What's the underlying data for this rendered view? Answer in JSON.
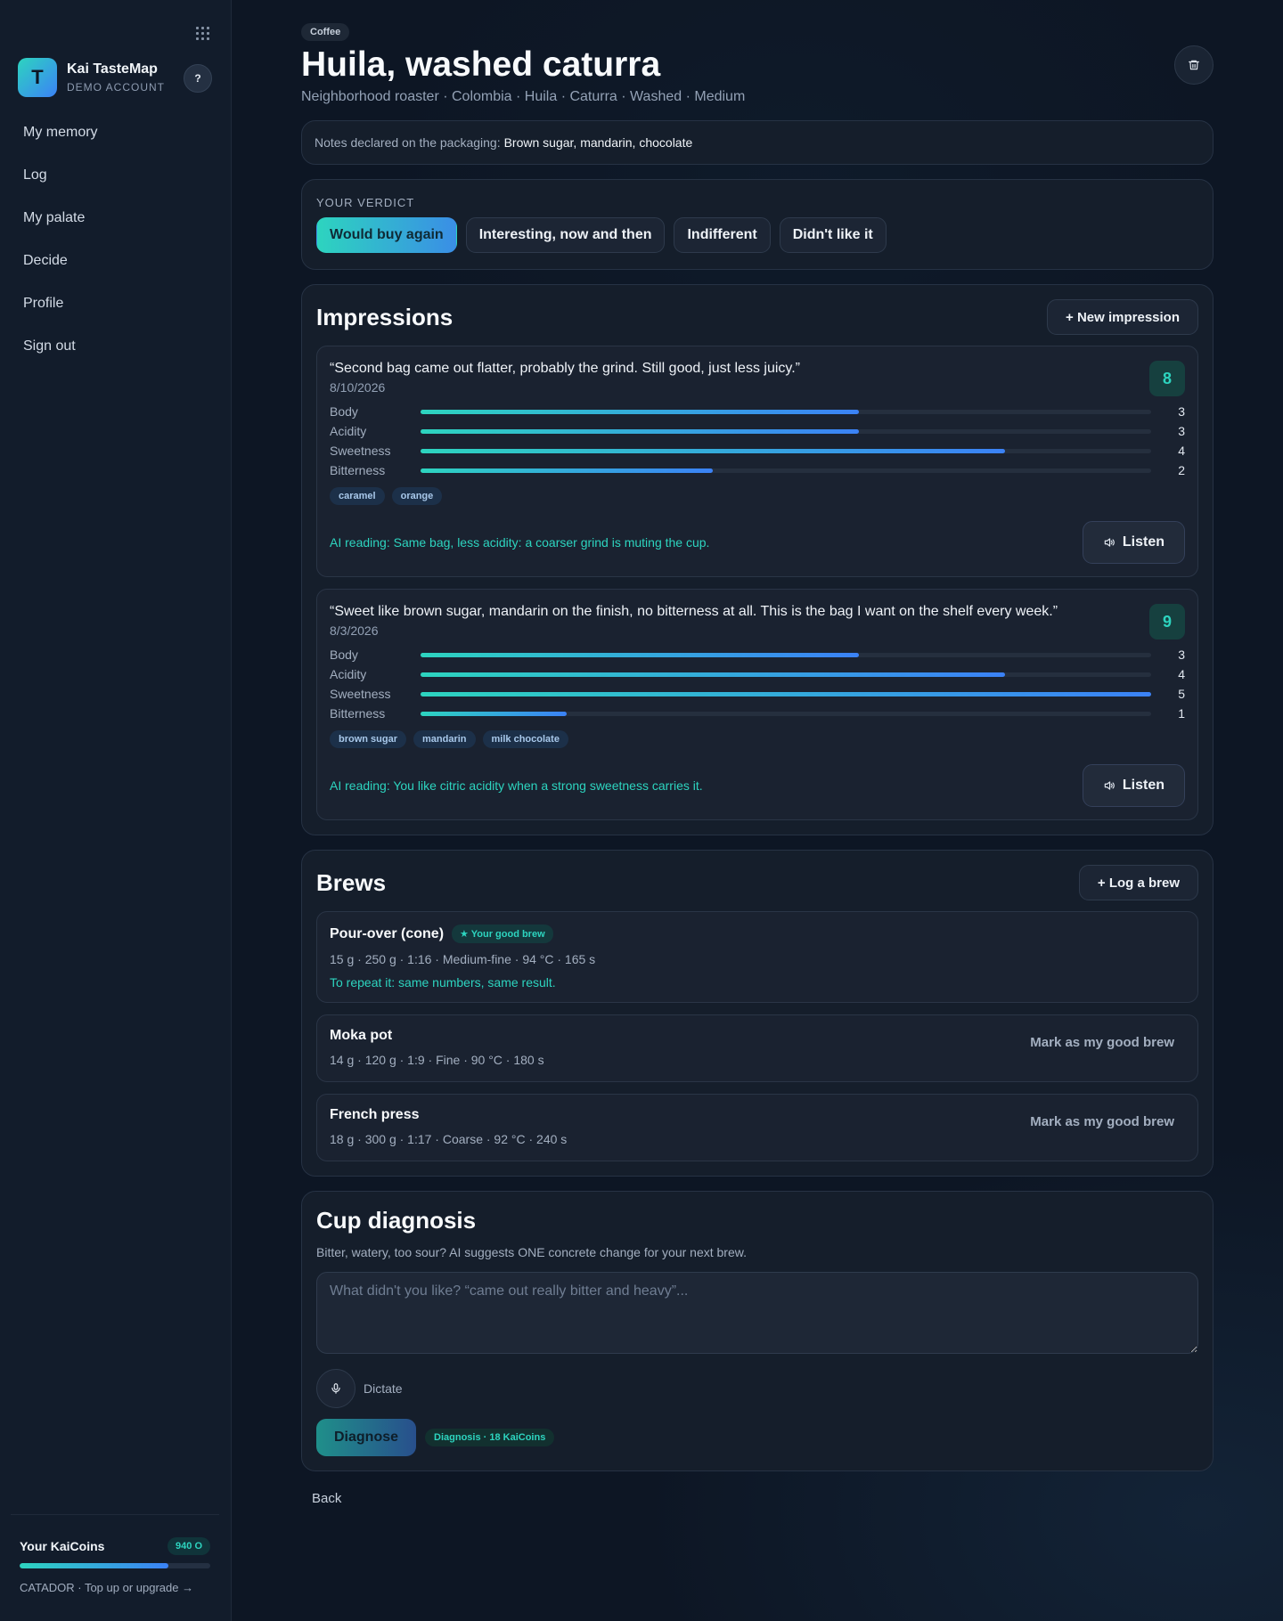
{
  "sidebar": {
    "brand_initial": "T",
    "brand_name": "Kai TasteMap",
    "brand_sub": "DEMO ACCOUNT",
    "help_label": "?",
    "nav": [
      {
        "label": "My memory"
      },
      {
        "label": "Log"
      },
      {
        "label": "My palate"
      },
      {
        "label": "Decide"
      },
      {
        "label": "Profile"
      },
      {
        "label": "Sign out"
      }
    ],
    "coins": {
      "title": "Your KaiCoins",
      "balance": "940 O",
      "progress": 0.78,
      "link": "CATADOR · Top up or upgrade →"
    }
  },
  "header": {
    "category": "Coffee",
    "title": "Huila, washed caturra",
    "subtitle": "Neighborhood roaster · Colombia · Huila · Caturra · Washed · Medium"
  },
  "notes": {
    "label": "Notes declared on the packaging:",
    "value": "Brown sugar, mandarin, chocolate"
  },
  "verdict": {
    "label": "YOUR VERDICT",
    "options": [
      {
        "label": "Would buy again",
        "active": true
      },
      {
        "label": "Interesting, now and then",
        "active": false
      },
      {
        "label": "Indifferent",
        "active": false
      },
      {
        "label": "Didn't like it",
        "active": false
      }
    ]
  },
  "impressions": {
    "title": "Impressions",
    "new_label": "+ New impression",
    "listen_label": "Listen",
    "max_value": 5,
    "items": [
      {
        "quote": "“Second bag came out flatter, probably the grind. Still good, just less juicy.”",
        "date": "8/10/2026",
        "score": "8",
        "metrics": [
          {
            "name": "Body",
            "value": 3
          },
          {
            "name": "Acidity",
            "value": 3
          },
          {
            "name": "Sweetness",
            "value": 4
          },
          {
            "name": "Bitterness",
            "value": 2
          }
        ],
        "tags": [
          "caramel",
          "orange"
        ],
        "ai_reading": "AI reading: Same bag, less acidity: a coarser grind is muting the cup."
      },
      {
        "quote": "“Sweet like brown sugar, mandarin on the finish, no bitterness at all. This is the bag I want on the shelf every week.”",
        "date": "8/3/2026",
        "score": "9",
        "metrics": [
          {
            "name": "Body",
            "value": 3
          },
          {
            "name": "Acidity",
            "value": 4
          },
          {
            "name": "Sweetness",
            "value": 5
          },
          {
            "name": "Bitterness",
            "value": 1
          }
        ],
        "tags": [
          "brown sugar",
          "mandarin",
          "milk chocolate"
        ],
        "ai_reading": "AI reading: You like citric acidity when a strong sweetness carries it."
      }
    ]
  },
  "brews": {
    "title": "Brews",
    "log_label": "+ Log a brew",
    "mark_label": "Mark as my good brew",
    "items": [
      {
        "method": "Pour-over (cone)",
        "good": true,
        "good_label": "★ Your good brew",
        "params": "15 g · 250 g · 1:16 · Medium-fine · 94 °C · 165 s",
        "hint": "To repeat it: same numbers, same result."
      },
      {
        "method": "Moka pot",
        "good": false,
        "params": "14 g · 120 g · 1:9 · Fine · 90 °C · 180 s"
      },
      {
        "method": "French press",
        "good": false,
        "params": "18 g · 300 g · 1:17 · Coarse · 92 °C · 240 s"
      }
    ]
  },
  "diagnosis": {
    "title": "Cup diagnosis",
    "subtitle": "Bitter, watery, too sour? AI suggests ONE concrete change for your next brew.",
    "placeholder": "What didn't you like? “came out really bitter and heavy”...",
    "dictate_label": "Dictate",
    "button_label": "Diagnose",
    "cost_label": "Diagnosis · 18 KaiCoins"
  },
  "back_label": "Back",
  "colors": {
    "accent_teal": "#2dd4bf",
    "accent_blue": "#3b82f6",
    "background": "#0d1624"
  }
}
